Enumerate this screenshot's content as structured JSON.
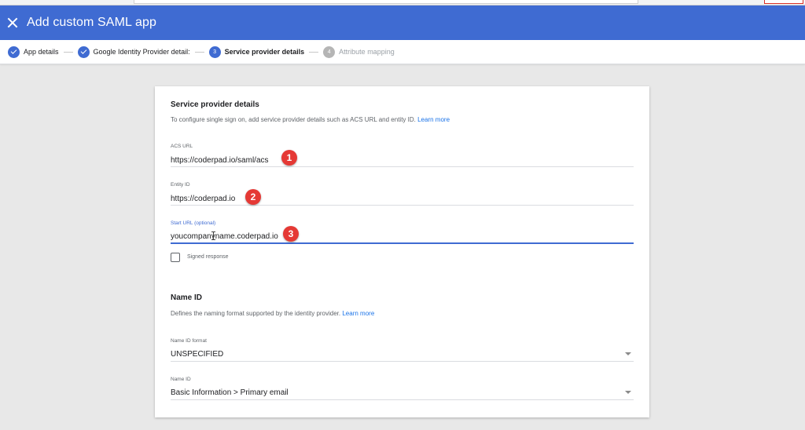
{
  "header": {
    "title": "Add custom SAML app"
  },
  "stepper": {
    "steps": [
      {
        "label": "App details",
        "state": "done"
      },
      {
        "label": "Google Identity Provider detail:",
        "state": "done"
      },
      {
        "label": "Service provider details",
        "number": "3",
        "state": "current"
      },
      {
        "label": "Attribute mapping",
        "number": "4",
        "state": "pending"
      }
    ]
  },
  "service_provider": {
    "title": "Service provider details",
    "description": "To configure single sign on, add service provider details such as ACS URL and entity ID.",
    "learn_more": "Learn more",
    "acs_url": {
      "label": "ACS URL",
      "value": "https://coderpad.io/saml/acs"
    },
    "entity_id": {
      "label": "Entity ID",
      "value": "https://coderpad.io"
    },
    "start_url": {
      "label": "Start URL (optional)",
      "value": "youcompanyname.coderpad.io"
    },
    "signed_response": {
      "label": "Signed response",
      "checked": false
    }
  },
  "name_id": {
    "title": "Name ID",
    "description": "Defines the naming format supported by the identity provider.",
    "learn_more": "Learn more",
    "format": {
      "label": "Name ID format",
      "value": "UNSPECIFIED"
    },
    "name_id": {
      "label": "Name ID",
      "value": "Basic Information > Primary email"
    }
  },
  "annotations": {
    "one": "1",
    "two": "2",
    "three": "3"
  },
  "colors": {
    "header": "#3f6bd2",
    "badge": "#e53935",
    "link": "#1a73e8",
    "page_bg": "#e8e8e8"
  }
}
